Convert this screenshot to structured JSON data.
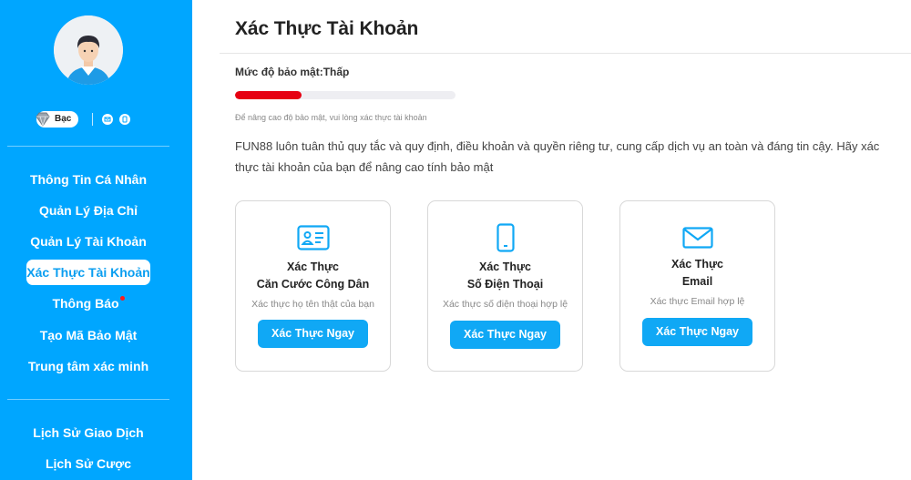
{
  "sidebar": {
    "tier": {
      "label": "Bạc",
      "icon": "diamond-icon"
    },
    "contact_icons": [
      "mail-icon",
      "phone-icon"
    ],
    "items": [
      {
        "label": "Thông Tin Cá Nhân",
        "active": false
      },
      {
        "label": "Quản Lý Địa Chỉ",
        "active": false
      },
      {
        "label": "Quản Lý Tài Khoản",
        "active": false
      },
      {
        "label": "Xác Thực Tài Khoản",
        "active": true
      },
      {
        "label": "Thông Báo",
        "active": false,
        "notification_dot": true
      },
      {
        "label": "Tạo Mã Bảo Mật",
        "active": false
      },
      {
        "label": "Trung tâm xác minh",
        "active": false
      }
    ],
    "history_items": [
      {
        "label": "Lịch Sử Giao Dịch"
      },
      {
        "label": "Lịch Sử Cược"
      }
    ]
  },
  "main": {
    "title": "Xác Thực Tài Khoản",
    "security_level": "Mức độ bảo mật:Thấp",
    "security_progress_percent": 30,
    "security_hint": "Để nâng cao độ bảo mật, vui lòng xác thực tài khoản",
    "description": "FUN88 luôn tuân thủ quy tắc và quy định, điều khoản và quyền riêng tư, cung cấp dịch vụ an toàn và đáng tin cậy. Hãy xác thực tài khoản của bạn để nâng cao tính bảo mật",
    "cards": [
      {
        "icon": "id-card-icon",
        "title_line1": "Xác Thực",
        "title_line2": "Căn Cước Công Dân",
        "subtitle": "Xác thực họ tên thật của bạn",
        "button": "Xác Thực Ngay"
      },
      {
        "icon": "smartphone-icon",
        "title_line1": "Xác Thực",
        "title_line2": "Số Điện Thoại",
        "subtitle": "Xác thực số điện thoại hợp lệ",
        "button": "Xác Thực Ngay"
      },
      {
        "icon": "envelope-icon",
        "title_line1": "Xác Thực",
        "title_line2": "Email",
        "subtitle": "Xác thực Email hợp lệ",
        "button": "Xác Thực Ngay"
      }
    ]
  },
  "colors": {
    "sidebar_bg": "#00a6ff",
    "accent": "#10a8f5",
    "progress_fill": "#e60012",
    "notification_dot": "#ff1a1a"
  }
}
